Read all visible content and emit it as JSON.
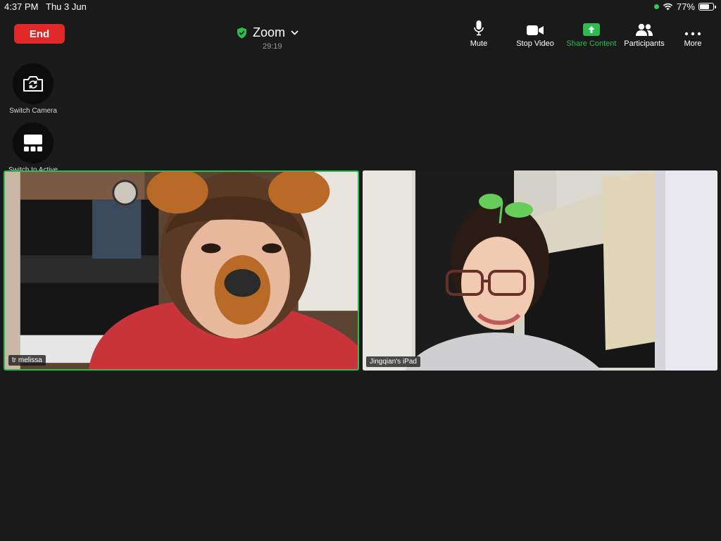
{
  "status_bar": {
    "time": "4:37 PM",
    "date": "Thu 3 Jun",
    "battery": "77%",
    "battery_level": 0.77
  },
  "header": {
    "end_label": "End",
    "meeting_title": "Zoom",
    "timer": "29:19"
  },
  "toolbar": {
    "mute": "Mute",
    "stop_video": "Stop Video",
    "share_content": "Share Content",
    "participants": "Participants",
    "more": "More"
  },
  "side": {
    "switch_camera": "Switch Camera",
    "switch_to_active_speaker": "Switch to Active Speaker"
  },
  "videos": [
    {
      "name": "tr melissa",
      "active_speaker": true
    },
    {
      "name": "Jingqian's  iPad",
      "active_speaker": false
    }
  ],
  "colors": {
    "end": "#e02828",
    "share": "#2dbd4e",
    "active_border": "#2dbd4e",
    "background": "#1a1a1a"
  }
}
